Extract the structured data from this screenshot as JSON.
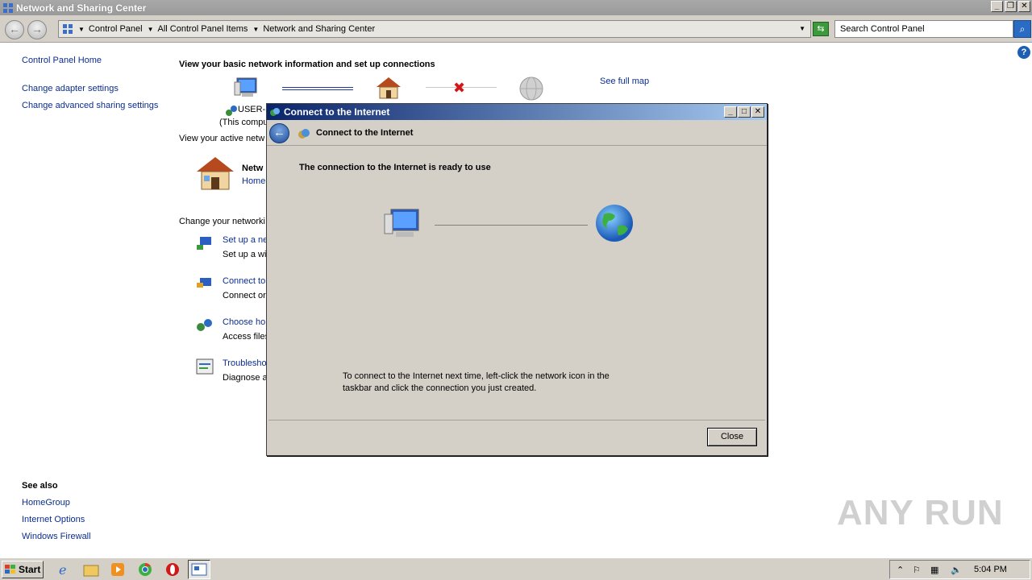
{
  "window": {
    "title": "Network and Sharing Center",
    "btn_min": "_",
    "btn_restore": "❐",
    "btn_close": "✕"
  },
  "address": {
    "crumbs": [
      "Control Panel",
      "All Control Panel Items",
      "Network and Sharing Center"
    ],
    "search_placeholder": "Search Control Panel"
  },
  "leftnav": {
    "home": "Control Panel Home",
    "adapter": "Change adapter settings",
    "advanced": "Change advanced sharing settings",
    "see_also_title": "See also",
    "see_also": [
      "HomeGroup",
      "Internet Options",
      "Windows Firewall"
    ]
  },
  "main": {
    "heading": "View your basic network information and set up connections",
    "see_full_map": "See full map",
    "pc_name": "USER-F",
    "pc_sub": "(This compu",
    "active_label": "View your active netw",
    "network_name": "Netw",
    "network_type": "Home",
    "change_label": "Change your networki",
    "tasks": [
      {
        "link": "Set up a ne",
        "desc": "Set up a wi"
      },
      {
        "link": "Connect to",
        "desc": "Connect or"
      },
      {
        "link": "Choose hor",
        "desc": "Access files"
      },
      {
        "link": "Troubleshoo",
        "desc": "Diagnose a"
      }
    ]
  },
  "dialog": {
    "title": "Connect to the Internet",
    "header": "Connect to the Internet",
    "ready": "The connection to the Internet is ready to use",
    "hint": "To connect to the Internet next time, left-click the network icon in the taskbar and click the connection you just created.",
    "close_label": "Close"
  },
  "taskbar": {
    "start_label": "Start",
    "clock": "5:04 PM"
  },
  "watermark": "ANY RUN"
}
